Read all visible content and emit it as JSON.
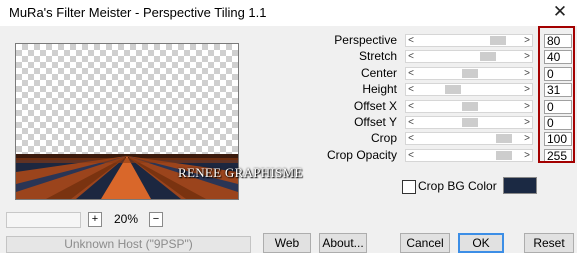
{
  "window": {
    "title": "MuRa's Filter Meister - Perspective Tiling 1.1",
    "close_glyph": "✕"
  },
  "preview": {
    "watermark": "RENEE GRAPHISME"
  },
  "zoom": {
    "plus": "+",
    "level": "20%",
    "minus": "−"
  },
  "params": [
    {
      "label": "Perspective",
      "value": "80",
      "fraction": 0.8
    },
    {
      "label": "Stretch",
      "value": "40",
      "fraction": 0.7
    },
    {
      "label": "Center",
      "value": "0",
      "fraction": 0.5
    },
    {
      "label": "Height",
      "value": "31",
      "fraction": 0.31
    },
    {
      "label": "Offset X",
      "value": "0",
      "fraction": 0.5
    },
    {
      "label": "Offset Y",
      "value": "0",
      "fraction": 0.5
    },
    {
      "label": "Crop",
      "value": "100",
      "fraction": 0.87
    },
    {
      "label": "Crop Opacity",
      "value": "255",
      "fraction": 0.87
    }
  ],
  "slider_arrows": {
    "left": "<",
    "right": ">"
  },
  "crop_bg": {
    "label": "Crop BG Color",
    "checked": false,
    "color": "#1b2943"
  },
  "footer": {
    "host": "Unknown Host (\"9PSP\")",
    "web": "Web",
    "about": "About...",
    "cancel": "Cancel",
    "ok": "OK",
    "reset": "Reset"
  },
  "colors": {
    "highlight": "#a30000",
    "floor_dark": "#1c2740",
    "floor_orange": "#c2541a"
  }
}
